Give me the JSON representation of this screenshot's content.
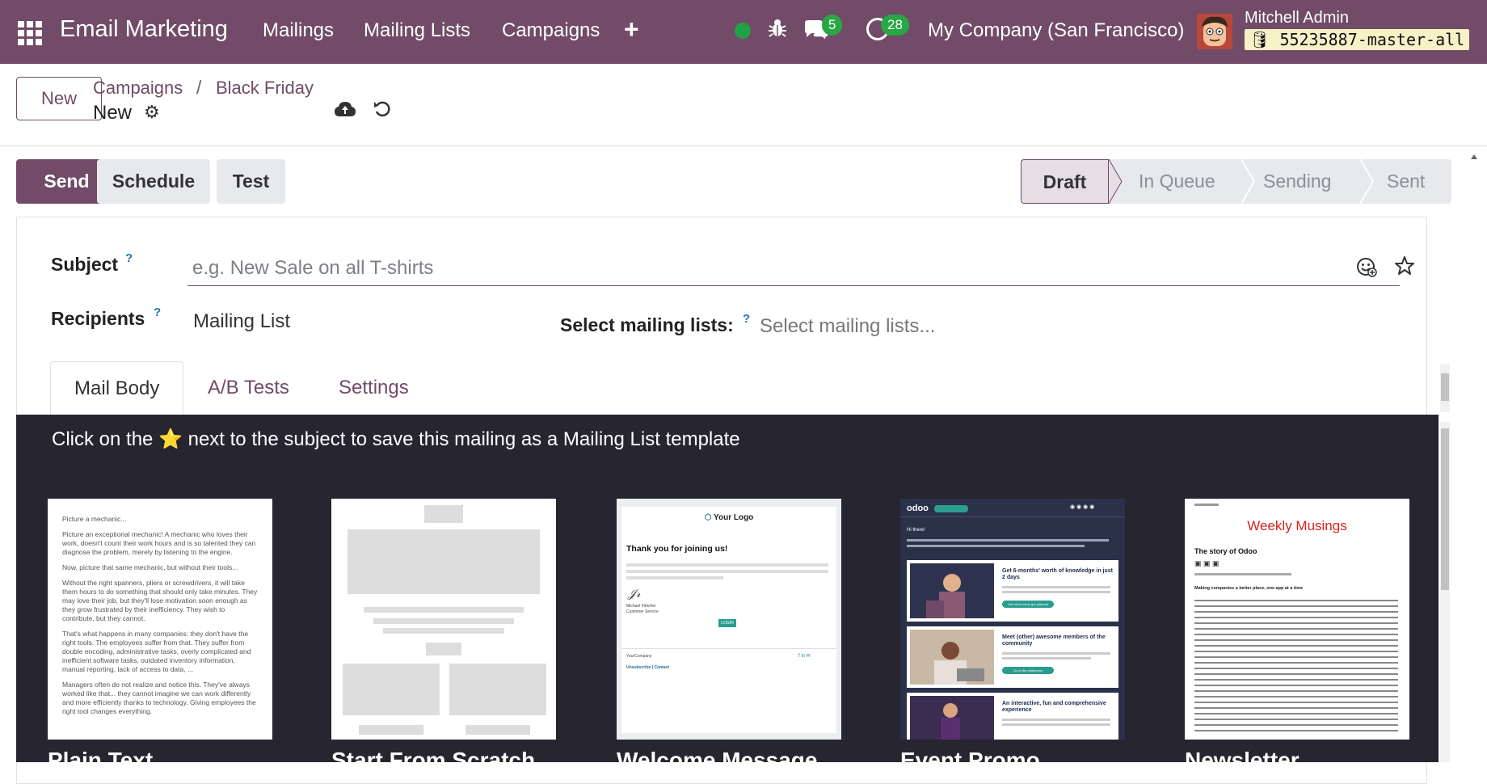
{
  "navbar": {
    "app_name": "Email Marketing",
    "menu": [
      "Mailings",
      "Mailing Lists",
      "Campaigns"
    ],
    "plus_icon": "plus-icon",
    "chat_count": "5",
    "activity_count": "28",
    "company": "My Company (San Francisco)",
    "user_name": "Mitchell Admin",
    "database": "55235887-master-all",
    "accent": "#714B67"
  },
  "control": {
    "new_label": "New",
    "breadcrumb": [
      "Campaigns",
      "Black Friday"
    ],
    "breadcrumb_sep": "/",
    "record_name": "New"
  },
  "statusbar": {
    "send_label": "Send",
    "schedule_label": "Schedule",
    "test_label": "Test",
    "stages": [
      "Draft",
      "In Queue",
      "Sending",
      "Sent"
    ],
    "active_stage": "Draft"
  },
  "form": {
    "subject_label": "Subject",
    "subject_placeholder": "e.g. New Sale on all T-shirts",
    "help_mark": "?",
    "recipients_label": "Recipients",
    "recipients_value": "Mailing List",
    "mailing_lists_label": "Select mailing lists:",
    "mailing_lists_placeholder": "Select mailing lists..."
  },
  "tabs": [
    "Mail Body",
    "A/B Tests",
    "Settings"
  ],
  "active_tab": "Mail Body",
  "editor": {
    "hint": "Click on the ⭐ next to the subject to save this mailing as a Mailing List template",
    "templates": [
      "Plain Text",
      "Start From Scratch",
      "Welcome Message",
      "Event Promo",
      "Newsletter"
    ],
    "welcome": {
      "logo": "Your Logo",
      "heading": "Thank you for joining us!",
      "signature_name": "Michael Fletcher",
      "signature_role": "Customer Service",
      "login": "LOGIN",
      "company": "YourCompany",
      "unsubscribe": "Unsubscribe | Contact"
    },
    "event": {
      "brand": "odoo",
      "greeting": "Hi there!",
      "items": [
        "Get 6-months' worth of knowledge in just 2 days",
        "Meet (other) awesome members of the community",
        "An interactive, fun and comprehensive experience"
      ],
      "buttons": [
        "See what we've got planned",
        "Go to the chatrooms"
      ]
    },
    "newsletter": {
      "title": "Weekly Musings",
      "story": "The story of Odoo",
      "section": "Making companies a better place, one app at a time"
    },
    "plain_text_lines": [
      "Picture a mechanic...",
      "Picture an exceptional mechanic! A mechanic who loves their work, doesn't count their work hours and is so talented they can diagnose the problem, merely by listening to the engine.",
      "Now, picture that same mechanic, but without their tools...",
      "Without the right spanners, pliers or screwdrivers, it will take them hours to do something that should only take minutes. They may love their job, but they'll lose motivation soon enough as they grow frustrated by their inefficiency. They wish to contribute, but they cannot.",
      "That's what happens in many companies: they don't have the right tools. The employees suffer from that. They suffer from double encoding, administrative tasks, overly complicated and inefficient software tasks, outdated inventory information, manual reporting, lack of access to data, ...",
      "Managers often do not realize and notice this. They've always worked like that... they cannot imagine we can work differently and more efficiently thanks to technology. Giving employees the right tool changes everything."
    ]
  }
}
